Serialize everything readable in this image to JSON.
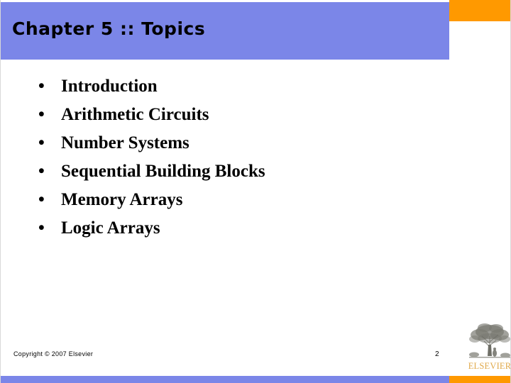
{
  "slide": {
    "title": "Chapter 5 :: Topics",
    "page_number": "2",
    "copyright": "Copyright © 2007 Elsevier",
    "bullet_char": "•",
    "topics": [
      {
        "label": "Introduction"
      },
      {
        "label": "Arithmetic Circuits"
      },
      {
        "label": "Number Systems"
      },
      {
        "label": "Sequential Building Blocks"
      },
      {
        "label": "Memory Arrays"
      },
      {
        "label": "Logic Arrays"
      }
    ],
    "logo": {
      "wordmark": "ELSEVIER",
      "icon_name": "elsevier-tree-icon"
    },
    "colors": {
      "banner_blue": "#7b86e8",
      "accent_orange": "#ff9900",
      "wordmark_gold": "#e0a94a",
      "text_black": "#000000",
      "background_white": "#ffffff"
    }
  }
}
